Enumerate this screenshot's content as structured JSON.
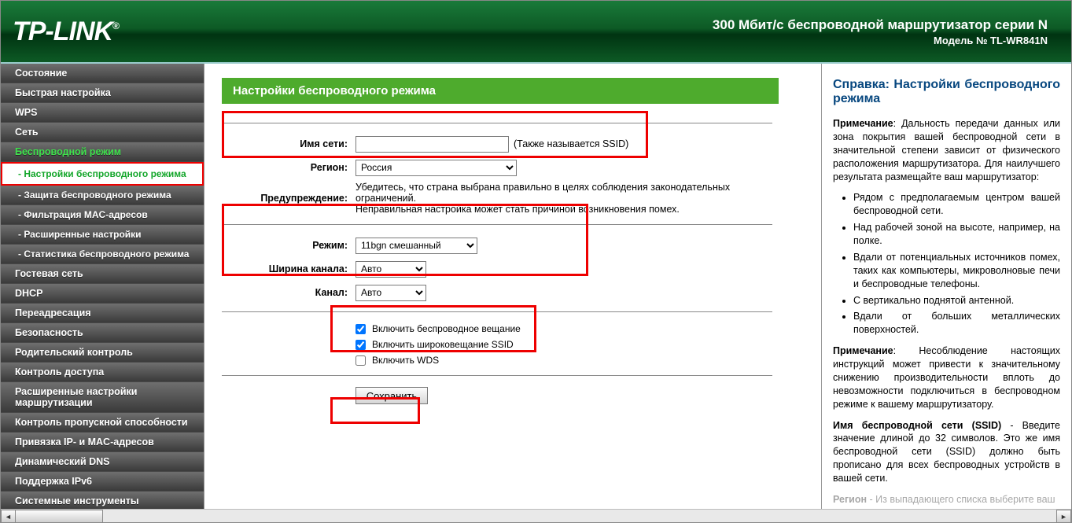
{
  "banner": {
    "logo": "TP-LINK",
    "logo_mark": "®",
    "line1": "300 Мбит/с беспроводной маршрутизатор серии N",
    "line2": "Модель № TL-WR841N"
  },
  "menu": {
    "items": [
      {
        "label": "Состояние",
        "kind": "top"
      },
      {
        "label": "Быстрая настройка",
        "kind": "top"
      },
      {
        "label": "WPS",
        "kind": "top"
      },
      {
        "label": "Сеть",
        "kind": "top"
      },
      {
        "label": "Беспроводной режим",
        "kind": "top",
        "active_parent": true
      },
      {
        "label": "- Настройки беспроводного режима",
        "kind": "sub",
        "active_sub": true
      },
      {
        "label": "- Защита беспроводного режима",
        "kind": "sub"
      },
      {
        "label": "- Фильтрация MAC-адресов",
        "kind": "sub"
      },
      {
        "label": "- Расширенные настройки",
        "kind": "sub"
      },
      {
        "label": "- Статистика беспроводного режима",
        "kind": "sub"
      },
      {
        "label": "Гостевая сеть",
        "kind": "top"
      },
      {
        "label": "DHCP",
        "kind": "top"
      },
      {
        "label": "Переадресация",
        "kind": "top"
      },
      {
        "label": "Безопасность",
        "kind": "top"
      },
      {
        "label": "Родительский контроль",
        "kind": "top"
      },
      {
        "label": "Контроль доступа",
        "kind": "top"
      },
      {
        "label": "Расширенные настройки маршрутизации",
        "kind": "top"
      },
      {
        "label": "Контроль пропускной способности",
        "kind": "top"
      },
      {
        "label": "Привязка IP- и MAC-адресов",
        "kind": "top"
      },
      {
        "label": "Динамический DNS",
        "kind": "top"
      },
      {
        "label": "Поддержка IPv6",
        "kind": "top"
      },
      {
        "label": "Системные инструменты",
        "kind": "top"
      }
    ]
  },
  "main": {
    "title": "Настройки беспроводного режима",
    "ssid_label": "Имя сети:",
    "ssid_value": "",
    "ssid_hint": "(Также называется SSID)",
    "region_label": "Регион:",
    "region_value": "Россия",
    "warn_label": "Предупреждение:",
    "warn_text1": "Убедитесь, что страна выбрана правильно в целях соблюдения законодательных ограничений.",
    "warn_text2": "Неправильная настройка может стать причиной возникновения помех.",
    "mode_label": "Режим:",
    "mode_value": "11bgn смешанный",
    "chwidth_label": "Ширина канала:",
    "chwidth_value": "Авто",
    "channel_label": "Канал:",
    "channel_value": "Авто",
    "cb_broadcast_label": "Включить беспроводное вещание",
    "cb_broadcast_checked": true,
    "cb_ssid_label": "Включить широковещание SSID",
    "cb_ssid_checked": true,
    "cb_wds_label": "Включить WDS",
    "cb_wds_checked": false,
    "save_label": "Сохранить"
  },
  "help": {
    "title": "Справка: Настройки беспроводного режима",
    "note_word": "Примечание",
    "p1": ": Дальность передачи данных или зона покрытия вашей беспроводной сети в значительной степени зависит от физического расположения маршрутизатора. Для наилучшего результата размещайте ваш маршрутизатор:",
    "bullets": [
      "Рядом с предполагаемым центром вашей беспроводной сети.",
      "Над рабочей зоной на высоте, например, на полке.",
      "Вдали от потенциальных источников помех, таких как компьютеры, микроволновые печи и беспроводные телефоны.",
      "С вертикально поднятой антенной.",
      "Вдали от больших металлических поверхностей."
    ],
    "p2a": "",
    "p2": ": Несоблюдение настоящих инструкций может привести к значительному снижению производительности вплоть до невозможности подключиться в беспроводном режиме к вашему маршрутизатору.",
    "ssid_bold": "Имя беспроводной сети (SSID)",
    "p3": " - Введите значение длиной до 32 символов. Это же имя беспроводной сети (SSID) должно быть прописано для всех беспроводных устройств в вашей сети.",
    "region_bold": "Регион",
    "p4_stub": " - Из выпадающего списка выберите ваш"
  }
}
